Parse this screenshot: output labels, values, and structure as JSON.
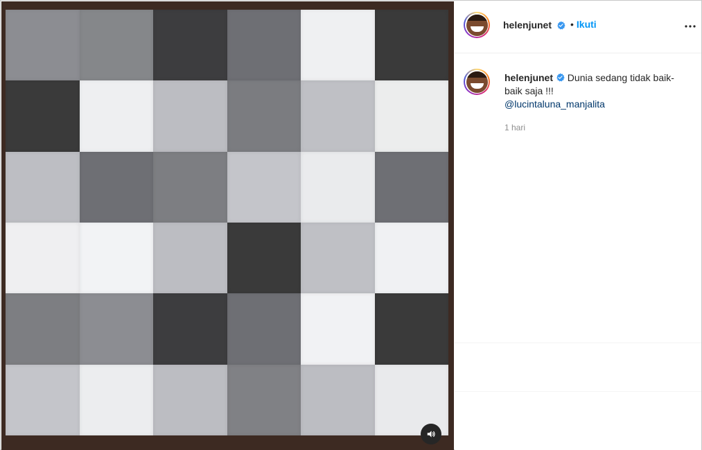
{
  "post": {
    "username": "helenjunet",
    "follow_label": "Ikuti",
    "separator": "•",
    "caption_text": "Dunia sedang tidak baik-baik saja !!!",
    "mention": "@lucintaluna_manjalita",
    "time": "1 hari"
  },
  "media": {
    "kind": "video",
    "tile_colors": [
      [
        "#8c8d92",
        "#85878a",
        "#3d3d3f",
        "#6e6f74",
        "#eff0f2",
        "#3a3a3a"
      ],
      [
        "#3a3a3a",
        "#eeeff1",
        "#bcbdc2",
        "#7b7c80",
        "#bfc0c5",
        "#eceded"
      ],
      [
        "#bdbec3",
        "#6e6f74",
        "#7d7e82",
        "#c4c5ca",
        "#eaebed",
        "#6e6f74"
      ],
      [
        "#efeff1",
        "#f2f3f5",
        "#bcbdc2",
        "#3a3a3a",
        "#bfc0c5",
        "#f0f1f3"
      ],
      [
        "#7d7e82",
        "#8c8d92",
        "#3d3d3f",
        "#6e6f74",
        "#f1f2f4",
        "#3a3a3a"
      ],
      [
        "#c4c5ca",
        "#ecedef",
        "#bcbdc2",
        "#808185",
        "#bcbdc2",
        "#e9eaec"
      ]
    ]
  },
  "icons": {
    "verified": "verified-badge-icon",
    "more": "more-options-icon",
    "sound": "speaker-icon"
  },
  "colors": {
    "accent": "#0095f6",
    "verified": "#3897f0",
    "mention": "#00376b",
    "media_border": "#3d2a22"
  }
}
